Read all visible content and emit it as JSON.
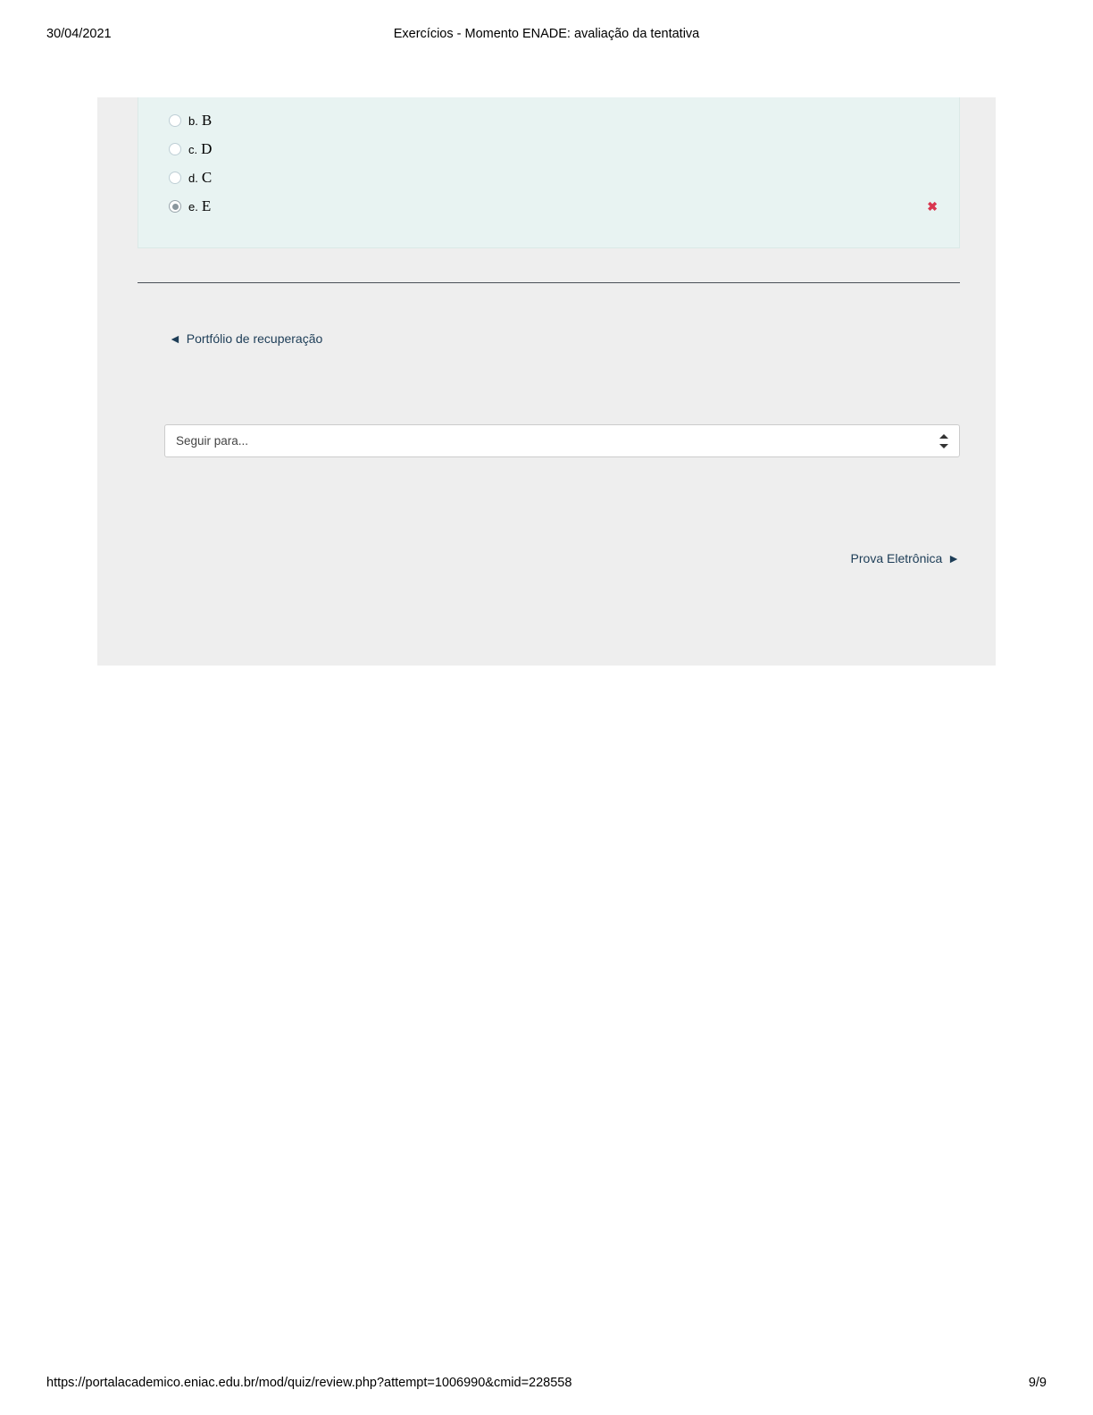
{
  "header": {
    "date": "30/04/2021",
    "title": "Exercícios - Momento ENADE: avaliação da tentativa"
  },
  "question": {
    "options": [
      {
        "index": "b.",
        "letter": "B",
        "selected": false,
        "wrong": false
      },
      {
        "index": "c.",
        "letter": "D",
        "selected": false,
        "wrong": false
      },
      {
        "index": "d.",
        "letter": "C",
        "selected": false,
        "wrong": false
      },
      {
        "index": "e.",
        "letter": "E",
        "selected": true,
        "wrong": true
      }
    ]
  },
  "nav": {
    "prev_arrow": "◄",
    "prev_label": "Portfólio de recuperação",
    "jump_placeholder": "Seguir para...",
    "next_label": "Prova Eletrônica",
    "next_arrow": "►"
  },
  "footer": {
    "url": "https://portalacademico.eniac.edu.br/mod/quiz/review.php?attempt=1006990&cmid=228558",
    "page": "9/9"
  }
}
